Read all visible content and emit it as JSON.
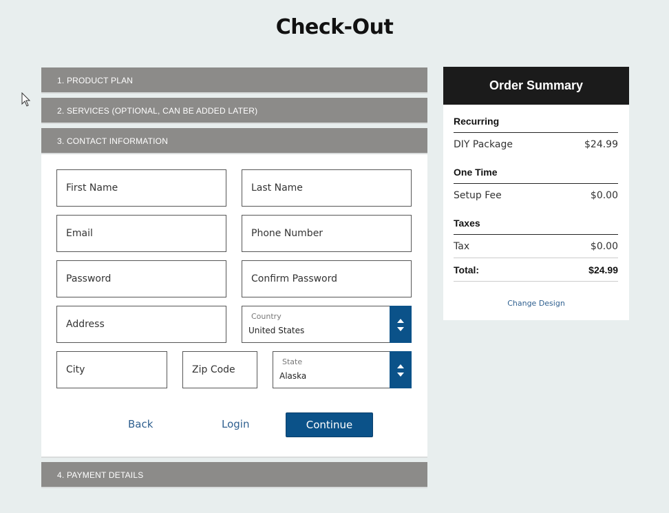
{
  "page": {
    "title": "Check-Out"
  },
  "accordion": {
    "step1": "1. PRODUCT PLAN",
    "step2": "2. SERVICES (OPTIONAL, CAN BE ADDED LATER)",
    "step3": "3. CONTACT INFORMATION",
    "step4": "4. PAYMENT DETAILS"
  },
  "form": {
    "first_name": "First Name",
    "last_name": "Last Name",
    "email": "Email",
    "phone": "Phone Number",
    "password": "Password",
    "confirm_password": "Confirm Password",
    "address": "Address",
    "country_label": "Country",
    "country_value": "United States",
    "city": "City",
    "zip": "Zip Code",
    "state_label": "State",
    "state_value": "Alaska"
  },
  "actions": {
    "back": "Back",
    "login": "Login",
    "continue": "Continue"
  },
  "summary": {
    "title": "Order Summary",
    "recurring_heading": "Recurring",
    "recurring_item": "DIY Package",
    "recurring_price": "$24.99",
    "onetime_heading": "One Time",
    "onetime_item": "Setup Fee",
    "onetime_price": "$0.00",
    "taxes_heading": "Taxes",
    "tax_item": "Tax",
    "tax_price": "$0.00",
    "total_label": "Total:",
    "total_value": "$24.99",
    "change_design": "Change Design"
  },
  "colors": {
    "accent": "#0b5289",
    "header_gray": "#8c8b89",
    "summary_header": "#1b1b1b",
    "background": "#e8eeee"
  }
}
